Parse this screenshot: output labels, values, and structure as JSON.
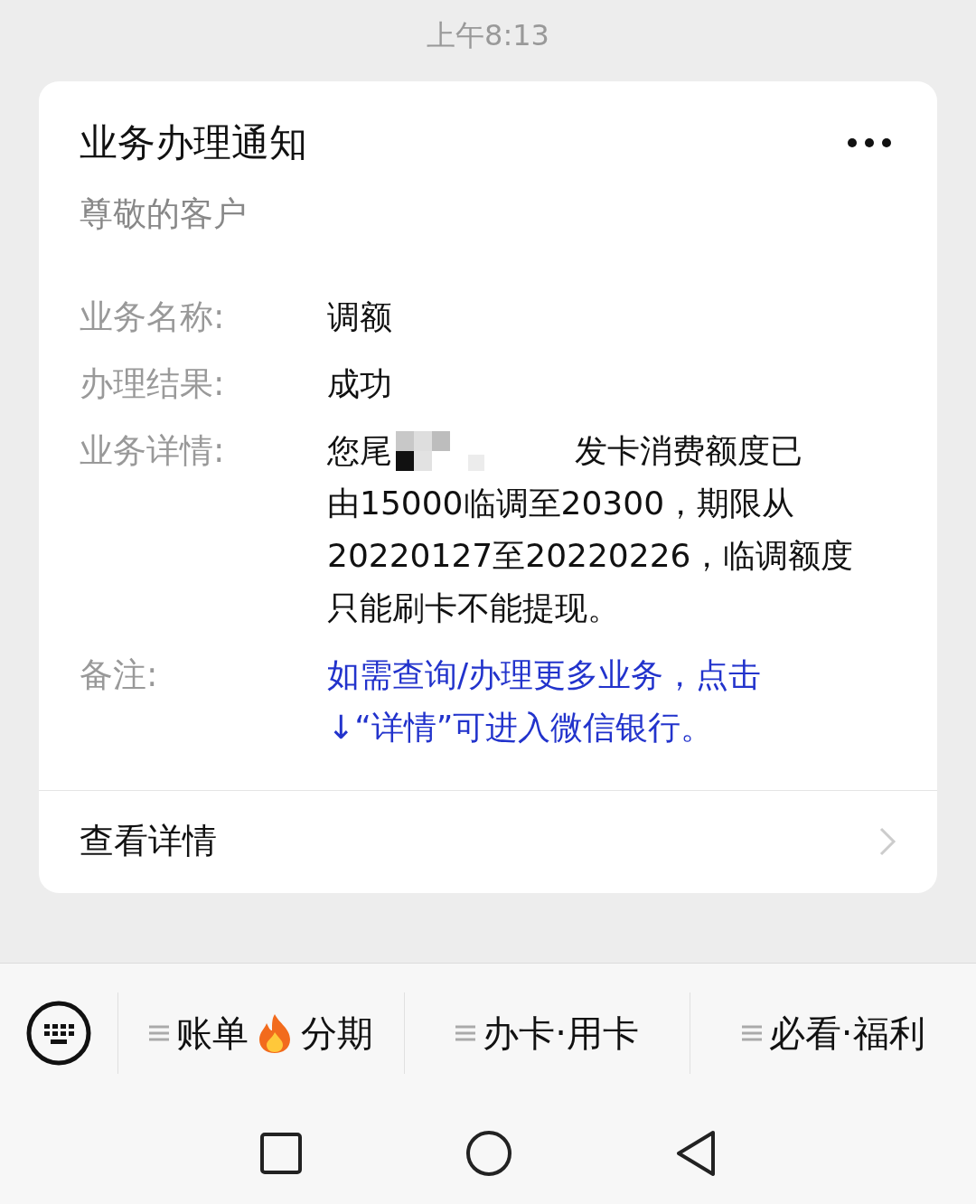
{
  "status_bar": {
    "time": "上午8:13"
  },
  "card": {
    "title": "业务办理通知",
    "greeting": "尊敬的客户",
    "fields": [
      {
        "label": "业务名称:",
        "value": "调额"
      },
      {
        "label": "办理结果:",
        "value": "成功"
      }
    ],
    "detail": {
      "label": "业务详情:",
      "head": "您尾",
      "tail": "发卡消费额度已",
      "lines": [
        "由15000临调至20300，期限从",
        "20220127至20220226，临调额度",
        "只能刷卡不能提现。"
      ]
    },
    "note": {
      "label": "备注:",
      "lines": [
        "如需查询/办理更多业务，点击",
        "↓“详情”可进入微信银行。"
      ]
    },
    "footer": {
      "label": "查看详情"
    }
  },
  "menu": [
    {
      "label": "账单",
      "label_after": "分期",
      "kind": "fire"
    },
    {
      "label": "办卡·用卡",
      "kind": "plain"
    },
    {
      "label": "必看·福利",
      "kind": "plain"
    }
  ]
}
